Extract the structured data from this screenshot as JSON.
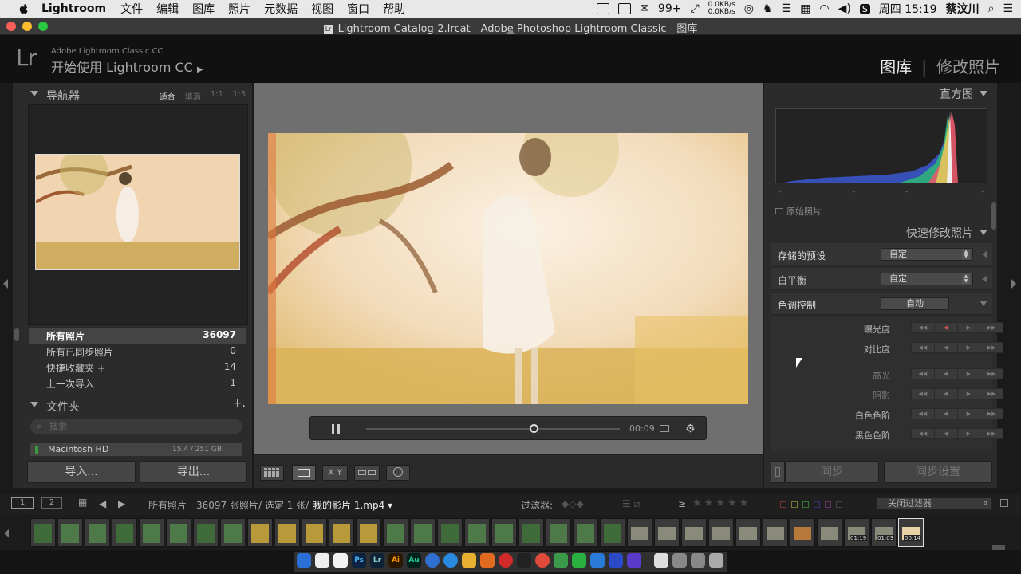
{
  "menubar": {
    "app_name": "Lightroom",
    "items": [
      "文件",
      "编辑",
      "图库",
      "照片",
      "元数据",
      "视图",
      "窗口",
      "帮助"
    ],
    "notification_count": "99+",
    "net_up": "0.0KB/s",
    "net_down": "0.0KB/s",
    "clock": "周四 15:19",
    "user": "蔡汶川"
  },
  "window": {
    "title": "Lightroom Catalog-2.lrcat - Adobe Photoshop Lightroom Classic - 图库"
  },
  "identity": {
    "logo": "Lr",
    "subtitle": "Adobe Lightroom Classic CC",
    "main": "开始使用 Lightroom CC",
    "play_icon": "▶",
    "module_library": "图库",
    "module_develop": "修改照片",
    "module_sep": "|"
  },
  "navigator": {
    "title": "导航器",
    "zoom": [
      "适合",
      "填满",
      "1:1",
      "1:3"
    ]
  },
  "catalog": {
    "rows": [
      {
        "name": "所有照片",
        "count": "36097"
      },
      {
        "name": "所有已同步照片",
        "count": "0"
      },
      {
        "name": "快捷收藏夹 +",
        "count": "14"
      },
      {
        "name": "上一次导入",
        "count": "1"
      }
    ]
  },
  "folders": {
    "title": "文件夹",
    "add": "+.",
    "search_placeholder": "搜索",
    "volume_name": "Macintosh HD",
    "volume_size": "15.4 / 251 GB"
  },
  "left_buttons": {
    "import": "导入...",
    "export": "导出..."
  },
  "video": {
    "time": "00:09",
    "position": 0.66
  },
  "toolbar": {
    "compare": "X Y"
  },
  "histogram": {
    "title": "直方图",
    "original": "原始照片",
    "ticks": [
      "–",
      "–",
      "–",
      "–"
    ]
  },
  "quick_develop": {
    "title": "快速修改照片",
    "preset_label": "存储的预设",
    "preset_value": "自定",
    "wb_label": "白平衡",
    "wb_value": "自定",
    "tone_label": "色调控制",
    "auto": "自动",
    "adjustments": [
      "曝光度",
      "对比度",
      "高光",
      "阴影",
      "白色色阶",
      "黑色色阶"
    ]
  },
  "right_buttons": {
    "sync": "同步",
    "sync_settings": "同步设置"
  },
  "filmstrip": {
    "page1": "1",
    "page2": "2",
    "source": "所有照片",
    "info": "36097 张照片/ 选定 1 张/",
    "file": "我的影片 1.mp4",
    "filter_label": "过滤器:",
    "ge": "≥",
    "stars": "★★★★★",
    "filter_value": "关闭过滤器",
    "video_badges": [
      "01:19",
      "01:03",
      "00:14"
    ]
  },
  "colors": {
    "accent_photo": "#f2dcc0",
    "panel": "#2b2b2b",
    "center_bg": "#6f6f6f"
  }
}
